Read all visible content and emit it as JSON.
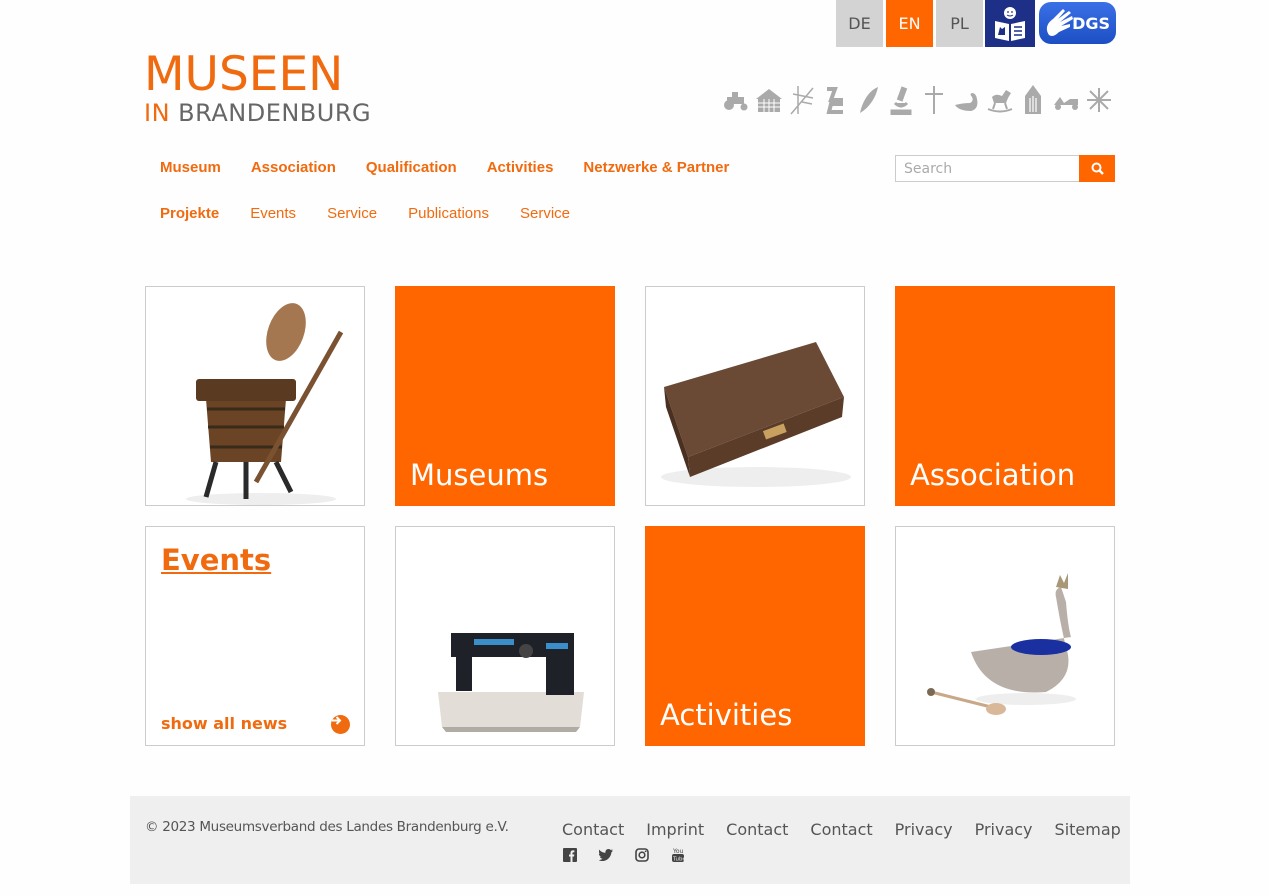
{
  "languages": [
    {
      "code": "DE",
      "active": false
    },
    {
      "code": "EN",
      "active": true
    },
    {
      "code": "PL",
      "active": false
    }
  ],
  "accessibility": {
    "easy_language_icon": "easy-read-icon",
    "sign_language_label": "DGS"
  },
  "logo": {
    "line1": "MUSEEN",
    "line2_prefix": "IN",
    "line2_main": "BRANDENBURG"
  },
  "pictograms": [
    "tractor-icon",
    "timber-house-icon",
    "telescope-icon",
    "chair-icon",
    "feather-icon",
    "microscope-icon",
    "cross-icon",
    "swan-icon",
    "rocking-horse-icon",
    "church-icon",
    "scooter-icon",
    "star-icon"
  ],
  "nav": {
    "primary": [
      "Museum",
      "Association",
      "Qualification",
      "Activities",
      "Netzwerke & Partner"
    ],
    "secondary": [
      {
        "label": "Projekte",
        "bold": true
      },
      {
        "label": "Events",
        "bold": false
      },
      {
        "label": "Service",
        "bold": false
      },
      {
        "label": "Publications",
        "bold": false
      },
      {
        "label": "Service",
        "bold": false
      }
    ]
  },
  "search": {
    "placeholder": "Search",
    "button_icon": "search-icon"
  },
  "tiles": {
    "t1": {
      "type": "image",
      "subject": "wooden butter churn"
    },
    "t2": {
      "type": "orange",
      "label": "Museums"
    },
    "t3": {
      "type": "image",
      "subject": "leather box"
    },
    "t4": {
      "type": "orange",
      "label": "Association"
    },
    "t5": {
      "type": "events",
      "title": "Events",
      "link": "show all news"
    },
    "t6": {
      "type": "image",
      "subject": "sewing machine"
    },
    "t7": {
      "type": "orange",
      "label": "Activities"
    },
    "t8": {
      "type": "image",
      "subject": "silver swan salt cellar"
    }
  },
  "footer": {
    "copyright": "© 2023 Museumsverband des Landes Brandenburg e.V.",
    "links": [
      "Contact",
      "Imprint",
      "Contact",
      "Contact",
      "Privacy",
      "Privacy",
      "Sitemap"
    ],
    "social": [
      "facebook-icon",
      "twitter-icon",
      "instagram-icon",
      "youtube-icon"
    ]
  },
  "colors": {
    "accent": "#ff6600",
    "text": "#555555",
    "footer_bg": "#f0eff0",
    "lang_inactive": "#d3d3d3",
    "easy_read_bg": "#1e2f88"
  }
}
